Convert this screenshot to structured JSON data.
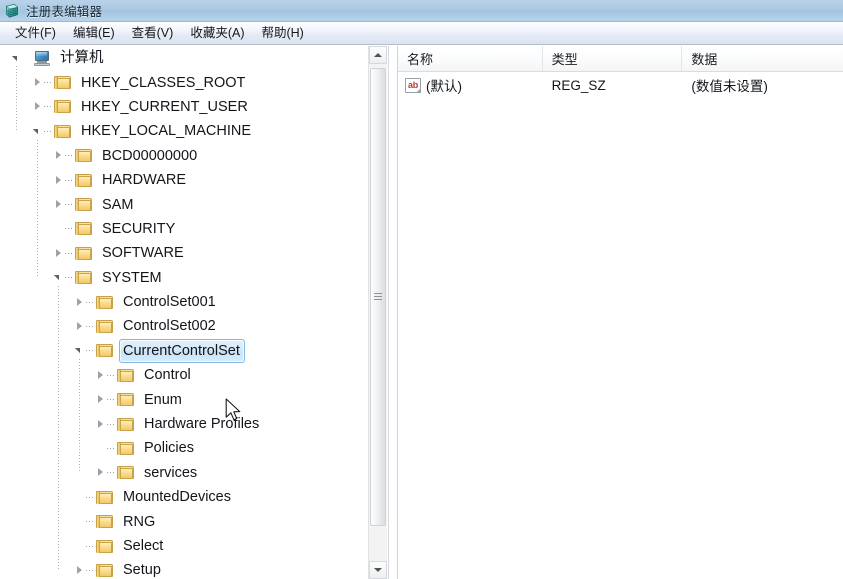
{
  "window": {
    "title": "注册表编辑器",
    "icon": "registry-editor-icon"
  },
  "menubar": {
    "items": [
      {
        "label": "文件(F)",
        "name": "menu-file"
      },
      {
        "label": "编辑(E)",
        "name": "menu-edit"
      },
      {
        "label": "查看(V)",
        "name": "menu-view"
      },
      {
        "label": "收藏夹(A)",
        "name": "menu-favorites"
      },
      {
        "label": "帮助(H)",
        "name": "menu-help"
      }
    ]
  },
  "tree": {
    "nodes": [
      {
        "label": "计算机",
        "depth": 0,
        "icon": "computer-icon",
        "state": "expanded",
        "selected": false
      },
      {
        "label": "HKEY_CLASSES_ROOT",
        "depth": 1,
        "icon": "folder-icon",
        "state": "collapsed",
        "selected": false
      },
      {
        "label": "HKEY_CURRENT_USER",
        "depth": 1,
        "icon": "folder-icon",
        "state": "collapsed",
        "selected": false
      },
      {
        "label": "HKEY_LOCAL_MACHINE",
        "depth": 1,
        "icon": "folder-icon",
        "state": "expanded",
        "selected": false
      },
      {
        "label": "BCD00000000",
        "depth": 2,
        "icon": "folder-icon",
        "state": "collapsed",
        "selected": false
      },
      {
        "label": "HARDWARE",
        "depth": 2,
        "icon": "folder-icon",
        "state": "collapsed",
        "selected": false
      },
      {
        "label": "SAM",
        "depth": 2,
        "icon": "folder-icon",
        "state": "collapsed",
        "selected": false
      },
      {
        "label": "SECURITY",
        "depth": 2,
        "icon": "folder-icon",
        "state": "leaf",
        "selected": false
      },
      {
        "label": "SOFTWARE",
        "depth": 2,
        "icon": "folder-icon",
        "state": "collapsed",
        "selected": false
      },
      {
        "label": "SYSTEM",
        "depth": 2,
        "icon": "folder-icon",
        "state": "expanded",
        "selected": false
      },
      {
        "label": "ControlSet001",
        "depth": 3,
        "icon": "folder-icon",
        "state": "collapsed",
        "selected": false
      },
      {
        "label": "ControlSet002",
        "depth": 3,
        "icon": "folder-icon",
        "state": "collapsed",
        "selected": false
      },
      {
        "label": "CurrentControlSet",
        "depth": 3,
        "icon": "folder-icon",
        "state": "expanded",
        "selected": true
      },
      {
        "label": "Control",
        "depth": 4,
        "icon": "folder-icon",
        "state": "collapsed",
        "selected": false
      },
      {
        "label": "Enum",
        "depth": 4,
        "icon": "folder-icon",
        "state": "collapsed",
        "selected": false
      },
      {
        "label": "Hardware Profiles",
        "depth": 4,
        "icon": "folder-icon",
        "state": "collapsed",
        "selected": false
      },
      {
        "label": "Policies",
        "depth": 4,
        "icon": "folder-icon",
        "state": "leaf",
        "selected": false
      },
      {
        "label": "services",
        "depth": 4,
        "icon": "folder-icon",
        "state": "collapsed",
        "selected": false
      },
      {
        "label": "MountedDevices",
        "depth": 3,
        "icon": "folder-icon",
        "state": "leaf",
        "selected": false
      },
      {
        "label": "RNG",
        "depth": 3,
        "icon": "folder-icon",
        "state": "leaf",
        "selected": false
      },
      {
        "label": "Select",
        "depth": 3,
        "icon": "folder-icon",
        "state": "leaf",
        "selected": false
      },
      {
        "label": "Setup",
        "depth": 3,
        "icon": "folder-icon",
        "state": "collapsed",
        "selected": false
      }
    ]
  },
  "list": {
    "columns": [
      {
        "label": "名称",
        "name": "column-name"
      },
      {
        "label": "类型",
        "name": "column-type"
      },
      {
        "label": "数据",
        "name": "column-data"
      }
    ],
    "rows": [
      {
        "icon": "string-value-icon",
        "name": "(默认)",
        "type": "REG_SZ",
        "data": "(数值未设置)"
      }
    ]
  },
  "scrollbar": {
    "up_arrow": "scroll-up-arrow",
    "down_arrow": "scroll-down-arrow"
  },
  "colors": {
    "titlebar_gradient_top": "#b9d2e8",
    "titlebar_gradient_bottom": "#b6d3ea",
    "selection_border": "#7fb7e3",
    "selection_fill": "#c7e1f7",
    "folder_yellow": "#f6d277",
    "string_icon_red": "#c0392b"
  }
}
